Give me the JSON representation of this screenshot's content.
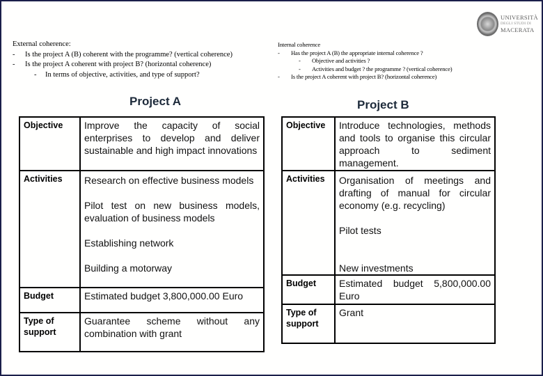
{
  "logo": {
    "line1": "UNIVERSITÀ",
    "line2": "DEGLI STUDI DI",
    "line3": "MACERATA"
  },
  "external_coherence": {
    "heading": "External coherence:",
    "items": [
      "Is the project A (B) coherent with the programme? (vertical coherence)",
      "Is the project A coherent with project B? (horizontal coherence)"
    ],
    "subitems": [
      "In terms of objective, activities, and type of support?"
    ]
  },
  "internal_coherence": {
    "heading": "Internal coherence",
    "item1": "Has the project A (B) the appropriate internal coherence ?",
    "subitems": [
      "Objective and activities ?",
      "Activities and budget ? the programme ? (vertical coherence)"
    ],
    "item2": "Is the project A coherent with project B? (horizontal coherence)"
  },
  "dash": "-",
  "project_a": {
    "title": "Project A",
    "rows": {
      "objective": {
        "label": "Objective",
        "value": "Improve the capacity of social enterprises to develop and deliver sustainable and high impact innovations"
      },
      "activities": {
        "label": "Activities",
        "values": [
          "Research on effective business models",
          "Pilot test on new business models, evaluation of business models",
          "Establishing network",
          "Building a motorway"
        ]
      },
      "budget": {
        "label": "Budget",
        "value": "Estimated budget 3,800,000.00 Euro"
      },
      "support": {
        "label": "Type of support",
        "value": "Guarantee scheme without any combination with grant"
      }
    }
  },
  "project_b": {
    "title": "Project B",
    "rows": {
      "objective": {
        "label": "Objective",
        "value": "Introduce technologies, methods and tools to organise this circular approach to sediment management."
      },
      "activities": {
        "label": "Activities",
        "values": [
          "Organisation of meetings and drafting of manual for circular economy (e.g. recycling)",
          "Pilot tests",
          "New investments"
        ]
      },
      "budget": {
        "label": "Budget",
        "value": "Estimated budget 5,800,000.00 Euro"
      },
      "support": {
        "label": "Type of support",
        "value": "Grant"
      }
    }
  }
}
